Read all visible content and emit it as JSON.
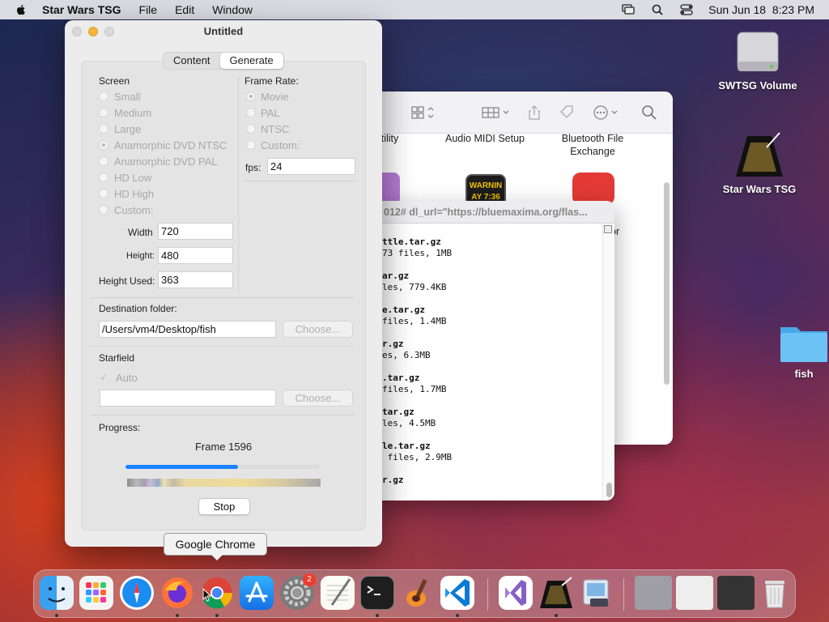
{
  "menubar": {
    "app_name": "Star Wars TSG",
    "menus": [
      "File",
      "Edit",
      "Window"
    ],
    "datetime": "Sun Jun 18  8:23 PM"
  },
  "desktop": {
    "icons": [
      {
        "label": "SWTSG Volume"
      },
      {
        "label": "Star Wars TSG"
      },
      {
        "label": "fish"
      }
    ]
  },
  "finder": {
    "apps": [
      {
        "label": "Utility"
      },
      {
        "label": "Audio MIDI Setup"
      },
      {
        "label": "Bluetooth File Exchange"
      },
      {
        "label": "or"
      }
    ],
    "warning_text": "WARNIN",
    "warning_sub": "AY 7:36"
  },
  "terminal": {
    "title": "012# dl_url=\"https://bluemaxima.org/flas...",
    "entries": [
      {
        "file": "ttle.tar.gz",
        "info": "73 files, 1MB"
      },
      {
        "file": "ar.gz",
        "info": "les, 779.4KB"
      },
      {
        "file": "e.tar.gz",
        "info": "files, 1.4MB"
      },
      {
        "file": "r.gz",
        "info": "es, 6.3MB"
      },
      {
        "file": ".tar.gz",
        "info": "files, 1.7MB"
      },
      {
        "file": "tar.gz",
        "info": "les, 4.5MB"
      },
      {
        "file": "le.tar.gz",
        "info": " files, 2.9MB"
      },
      {
        "file": "r.gz",
        "info": ""
      }
    ]
  },
  "window": {
    "title": "Untitled",
    "tabs": [
      "Content",
      "Generate"
    ],
    "active_tab": "Generate",
    "screen": {
      "label": "Screen",
      "options": [
        "Small",
        "Medium",
        "Large",
        "Anamorphic DVD NTSC",
        "Anamorphic DVD PAL",
        "HD Low",
        "HD High",
        "Custom:"
      ],
      "selected": "Anamorphic DVD NTSC"
    },
    "frame_rate": {
      "label": "Frame Rate:",
      "options": [
        "Movie",
        "PAL",
        "NTSC",
        "Custom:"
      ],
      "selected": "Movie",
      "fps_label": "fps:",
      "fps_value": "24"
    },
    "dims": {
      "width_label": "Width",
      "width_value": "720",
      "height_label": "Height:",
      "height_value": "480",
      "height_used_label": "Height Used:",
      "height_used_value": "363"
    },
    "destination": {
      "label": "Destination folder:",
      "value": "/Users/vm4/Desktop/fish",
      "choose": "Choose..."
    },
    "starfield": {
      "label": "Starfield",
      "auto_label": "Auto",
      "auto_checked": true,
      "value": "",
      "choose": "Choose..."
    },
    "progress": {
      "label": "Progress:",
      "frame_text": "Frame 1596",
      "fraction": 0.58,
      "stop_label": "Stop"
    }
  },
  "tooltip": {
    "text": "Google Chrome"
  },
  "dock": {
    "items": [
      "Finder",
      "Launchpad",
      "Safari",
      "Firefox",
      "Google Chrome",
      "App Store",
      "System Settings",
      "TextEdit",
      "Terminal",
      "GarageBand",
      "Visual Studio Code",
      "Visual Studio",
      "Star Wars TSG",
      "Preview",
      "Recent 1",
      "Recent 2",
      "Recent 3",
      "Trash"
    ],
    "settings_badge": "2"
  },
  "colors": {
    "accent": "#1a84ff",
    "close": "#d6d6d6",
    "minimize": "#f6b43c"
  }
}
